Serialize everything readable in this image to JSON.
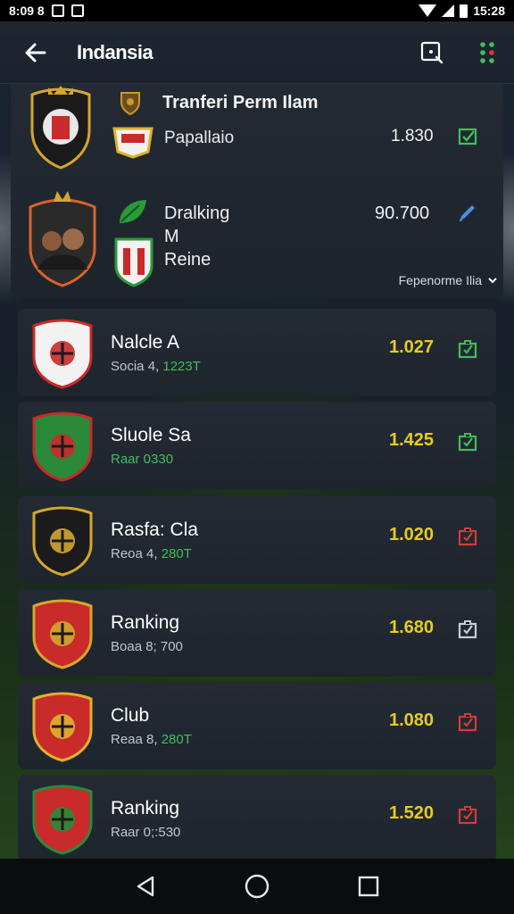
{
  "status_bar": {
    "left_text": "8:09 8",
    "time": "15:28"
  },
  "app_bar": {
    "title": "Indansia",
    "back_icon": "arrow-left-icon",
    "search_icon": "search-icon",
    "menu_icon": "more-dots-icon"
  },
  "top_card": {
    "title": "Tranferi Perm Ilam",
    "subtitle": "Papallaio",
    "value1": "1.830",
    "row2_line1": "Dralking",
    "row2_line2": "M",
    "row2_line3": "Reine",
    "value2": "90.700",
    "more_label": "Fepenorme Ilia"
  },
  "rows": [
    {
      "name": "Nalcle A",
      "meta_prefix": "Socia 4, ",
      "meta_hl": "1223T",
      "value": "1.027",
      "icon_color": "#3fbf5a"
    },
    {
      "name": "Sluole Sa",
      "meta_prefix": "",
      "meta_hl": "Raar 0330",
      "value": "1.425",
      "icon_color": "#3fbf5a"
    },
    {
      "name": "Rasfa: Cla",
      "meta_prefix": "Reoa 4, ",
      "meta_hl": "280T",
      "value": "1.020",
      "icon_color": "#d83a3a"
    },
    {
      "name": "Ranking",
      "meta_prefix": "Boaa 8; 700",
      "meta_hl": "",
      "value": "1.680",
      "icon_color": "#c9ced4"
    },
    {
      "name": "Club",
      "meta_prefix": "Reaa 8, ",
      "meta_hl": "280T",
      "value": "1.080",
      "icon_color": "#d83a3a"
    },
    {
      "name": "Ranking",
      "meta_prefix": "Raar 0;:530",
      "meta_hl": "",
      "value": "1.520",
      "icon_color": "#d83a3a"
    }
  ],
  "colors": {
    "accent_yellow": "#e6cc1f",
    "accent_green": "#3fbf5a",
    "accent_red": "#d83a3a",
    "card": "#232a33"
  }
}
